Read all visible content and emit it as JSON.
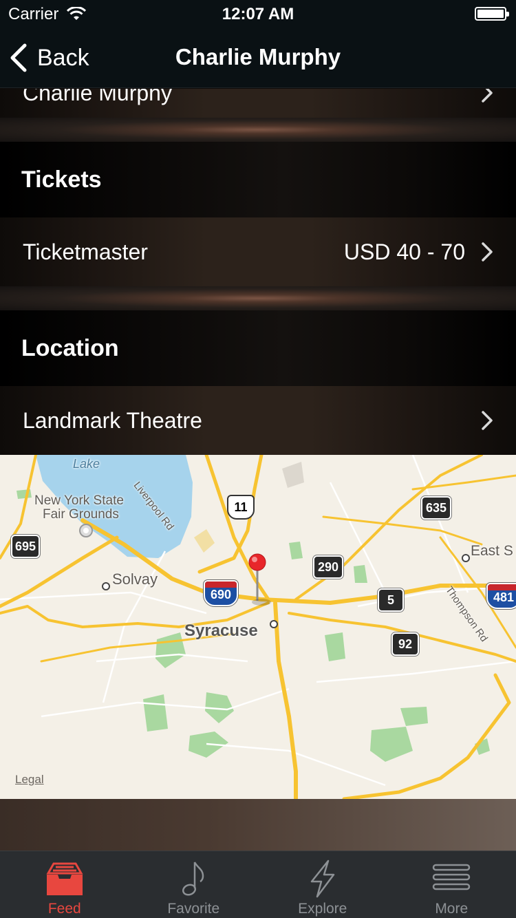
{
  "status_bar": {
    "carrier": "Carrier",
    "time": "12:07 AM"
  },
  "nav": {
    "back_label": "Back",
    "title": "Charlie Murphy"
  },
  "rows": {
    "performer": {
      "label": "Charlie Murphy"
    },
    "tickets_header": "Tickets",
    "ticket_row": {
      "label": "Ticketmaster",
      "value": "USD 40 - 70"
    },
    "location_header": "Location",
    "location_row": {
      "label": "Landmark Theatre"
    }
  },
  "map": {
    "labels": {
      "lake": "Lake",
      "fairgrounds_line1": "New York State",
      "fairgrounds_line2": "Fair Grounds",
      "liverpool_rd": "Liverpool Rd",
      "solvay": "Solvay",
      "syracuse": "Syracuse",
      "east": "East S",
      "thompson_rd": "Thompson Rd"
    },
    "shields": {
      "r695": "695",
      "us11": "11",
      "r635": "635",
      "r290": "290",
      "i690": "690",
      "r5": "5",
      "r92": "92",
      "i481": "481"
    },
    "legal": "Legal"
  },
  "tab_bar": {
    "items": [
      {
        "label": "Feed",
        "icon": "inbox-icon"
      },
      {
        "label": "Favorite",
        "icon": "music-note-icon"
      },
      {
        "label": "Explore",
        "icon": "lightning-icon"
      },
      {
        "label": "More",
        "icon": "menu-icon"
      }
    ],
    "active_color": "#e8473f",
    "inactive_color": "#8d9195"
  }
}
